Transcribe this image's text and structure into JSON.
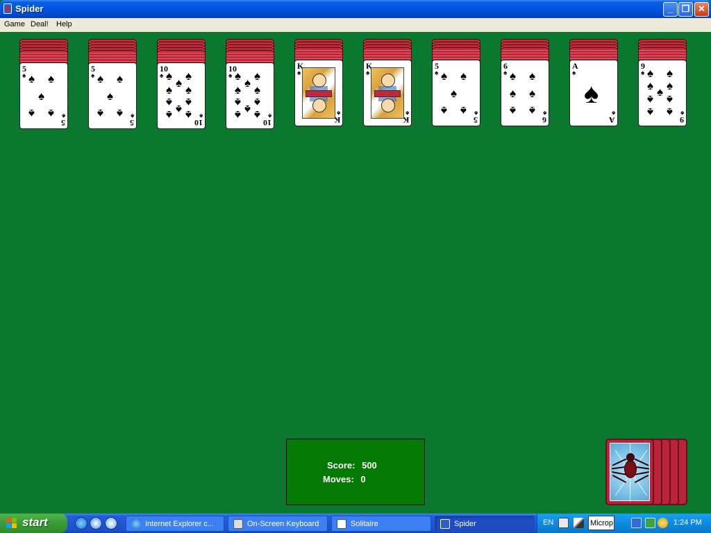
{
  "window": {
    "title": "Spider"
  },
  "menu": [
    "Game",
    "Deal!",
    "Help"
  ],
  "tableau": [
    {
      "facedown": 5,
      "card": {
        "rank": "5",
        "suit": "♠"
      }
    },
    {
      "facedown": 5,
      "card": {
        "rank": "5",
        "suit": "♠"
      }
    },
    {
      "facedown": 5,
      "card": {
        "rank": "10",
        "suit": "♠"
      }
    },
    {
      "facedown": 5,
      "card": {
        "rank": "10",
        "suit": "♠"
      }
    },
    {
      "facedown": 4,
      "card": {
        "rank": "K",
        "suit": "♠"
      }
    },
    {
      "facedown": 4,
      "card": {
        "rank": "K",
        "suit": "♠"
      }
    },
    {
      "facedown": 4,
      "card": {
        "rank": "5",
        "suit": "♠"
      }
    },
    {
      "facedown": 4,
      "card": {
        "rank": "6",
        "suit": "♠"
      }
    },
    {
      "facedown": 4,
      "card": {
        "rank": "A",
        "suit": "♠"
      }
    },
    {
      "facedown": 4,
      "card": {
        "rank": "9",
        "suit": "♠"
      }
    }
  ],
  "status": {
    "score_label": "Score:",
    "score_value": "500",
    "moves_label": "Moves:",
    "moves_value": "0"
  },
  "stock": {
    "remaining_deals": 5
  },
  "taskbar": {
    "start_label": "start",
    "tasks": [
      {
        "label": "Internet Explorer c...",
        "icon": "internet-explorer-icon",
        "active": false
      },
      {
        "label": "On-Screen Keyboard",
        "icon": "keyboard-icon",
        "active": false
      },
      {
        "label": "Solitaire",
        "icon": "solitaire-icon",
        "active": false
      },
      {
        "label": "Spider",
        "icon": "spider-icon",
        "active": true
      }
    ],
    "language": "EN",
    "tray_input": "Microp",
    "clock": "1:24 PM"
  },
  "colors": {
    "felt": "#0b7a30",
    "card_back": "#c0283c",
    "score_box": "#047a04",
    "taskbar": "#2055d3",
    "start_button": "#3c9c37"
  }
}
